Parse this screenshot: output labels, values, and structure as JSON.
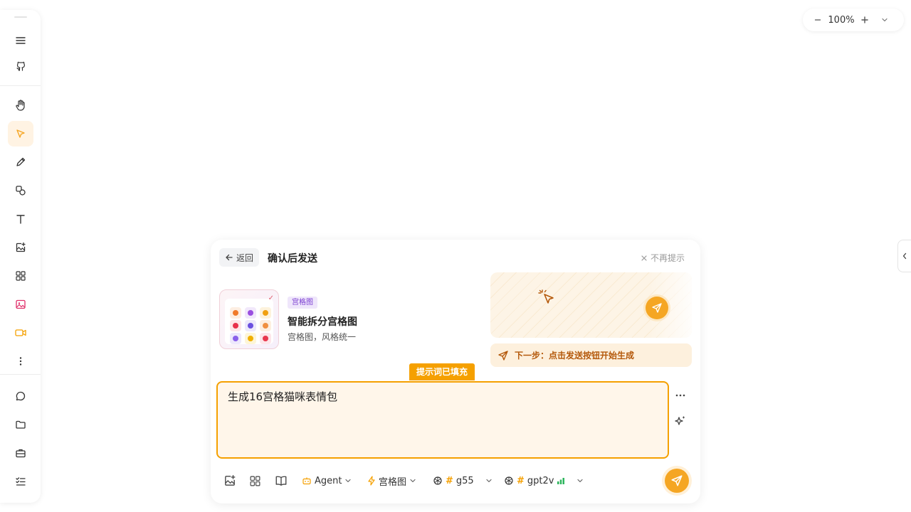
{
  "left_toolbar": {
    "tools": [
      {
        "name": "menu-icon"
      },
      {
        "name": "github-icon"
      },
      {
        "name": "hand-icon"
      },
      {
        "name": "pointer-icon",
        "active": true
      },
      {
        "name": "pencil-icon"
      },
      {
        "name": "shapes-icon"
      },
      {
        "name": "text-icon"
      },
      {
        "name": "image-add-icon"
      },
      {
        "name": "grid-icon"
      },
      {
        "name": "image-icon"
      },
      {
        "name": "video-icon"
      },
      {
        "name": "more-vertical-icon"
      },
      {
        "name": "chat-icon"
      },
      {
        "name": "folder-icon"
      },
      {
        "name": "briefcase-icon"
      },
      {
        "name": "checklist-icon"
      }
    ]
  },
  "zoom": {
    "value": "100%"
  },
  "panel": {
    "back_label": "返回",
    "title": "确认后发送",
    "dismiss_label": "不再提示",
    "card": {
      "tag": "宫格图",
      "title": "智能拆分宫格图",
      "subtitle": "宫格图，风格统一"
    },
    "hint_text": "下一步：点击发送按钮开始生成",
    "fill_badge": "提示词已填充",
    "prompt_value": "生成16宫格猫咪表情包",
    "bottom": {
      "agent_label": "Agent",
      "mode_label": "宫格图",
      "model1_label": "g55",
      "model2_label": "gpt2v"
    }
  },
  "colors": {
    "accent": "#f5a623",
    "accent_strong": "#f5a000",
    "hint_text": "#b4580a",
    "tag_purple": "#7b3fd1"
  }
}
